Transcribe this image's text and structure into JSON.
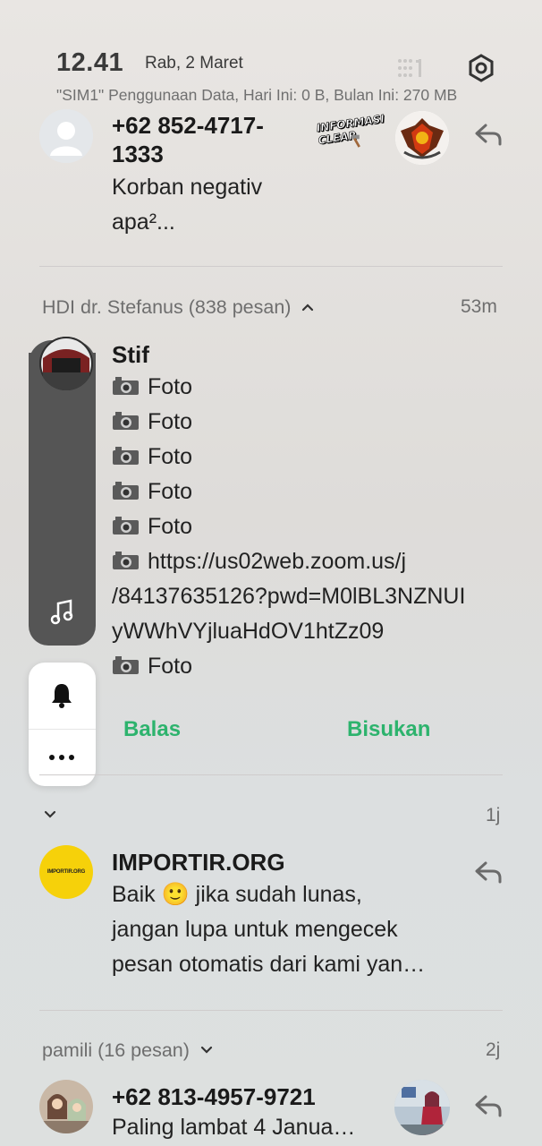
{
  "status": {
    "time": "12.41",
    "date": "Rab, 2 Maret",
    "data_usage": "\"SIM1\" Penggunaan Data, Hari Ini: 0 B, Bulan Ini: 270 MB"
  },
  "notif1": {
    "sender_line1": "+62 852-4717-",
    "sender_line2": "1333",
    "message_line1": "Korban negativ",
    "message_line2": "apa²...",
    "sticker_text_1": "INFORMASI",
    "sticker_text_2": "CLEAR"
  },
  "group1": {
    "title": "HDI dr. Stefanus (838 pesan)",
    "time": "53m",
    "sender": "Stif",
    "lines": [
      "Foto",
      "Foto",
      "Foto",
      "Foto",
      "Foto",
      "https://us02web.zoom.us/j",
      "/84137635126?pwd=M0lBL3NZNUI",
      "yWWhVYjluaHdOV1htZz09",
      "Foto"
    ],
    "reply_label": "Balas",
    "mute_label": "Bisukan"
  },
  "collapsed": {
    "time": "1j"
  },
  "notif2": {
    "sender": "IMPORTIR.ORG",
    "avatar_text": "IMPORTIR.ORG",
    "message_line1": "Baik 🙂 jika sudah lunas,",
    "message_line2": "jangan lupa untuk mengecek",
    "message_line3": "pesan otomatis dari kami yan…"
  },
  "group2": {
    "title": "pamili (16 pesan)",
    "time": "2j",
    "sender": "+62 813-4957-9721",
    "message": "Paling lambat 4 Janua…"
  },
  "colors": {
    "accent_green": "#2db36d",
    "importir_yellow": "#f6d10a"
  }
}
